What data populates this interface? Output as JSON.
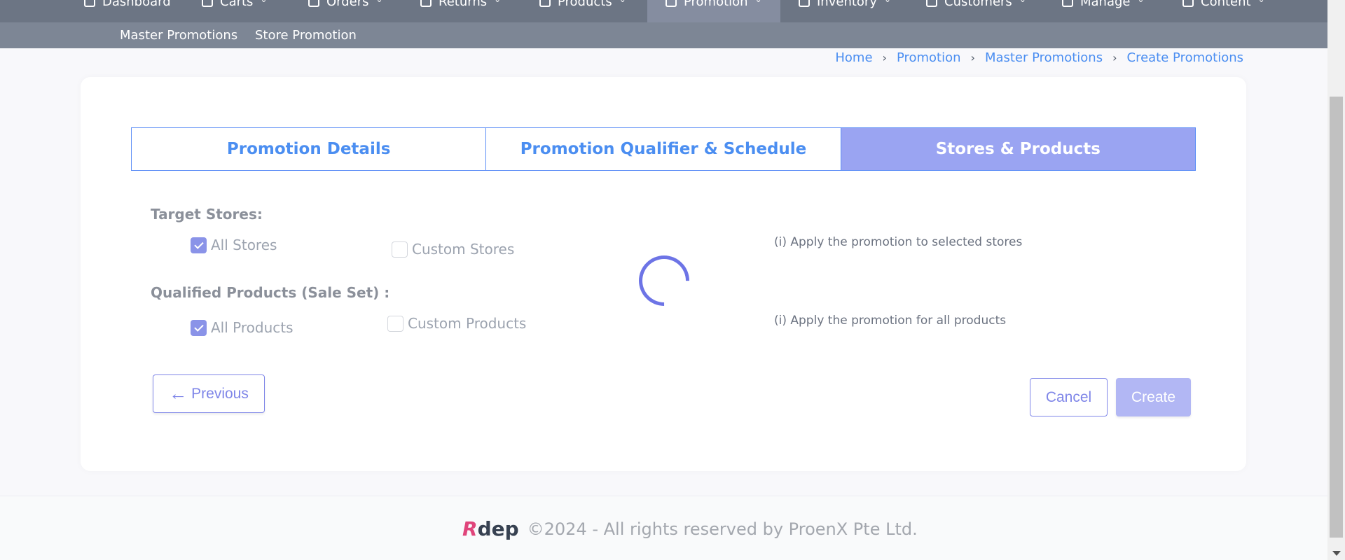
{
  "nav": {
    "items": [
      {
        "label": "Dashboard",
        "icon": "dashboard-icon"
      },
      {
        "label": "Carts",
        "icon": "cart-icon"
      },
      {
        "label": "Orders",
        "icon": "orders-icon"
      },
      {
        "label": "Returns",
        "icon": "returns-icon"
      },
      {
        "label": "Products",
        "icon": "products-icon"
      },
      {
        "label": "Promotion",
        "icon": "promotion-icon"
      },
      {
        "label": "Inventory",
        "icon": "inventory-icon"
      },
      {
        "label": "Customers",
        "icon": "customers-icon"
      },
      {
        "label": "Manage",
        "icon": "gear-icon"
      },
      {
        "label": "Content",
        "icon": "content-icon"
      }
    ],
    "active": "Promotion"
  },
  "subnav": {
    "items": [
      "Master Promotions",
      "Store Promotion"
    ]
  },
  "breadcrumb": {
    "items": [
      "Home",
      "Promotion",
      "Master Promotions",
      "Create Promotions"
    ]
  },
  "tabs": {
    "items": [
      "Promotion Details",
      "Promotion Qualifier & Schedule",
      "Stores & Products"
    ],
    "active": "Stores & Products"
  },
  "target_stores": {
    "label": "Target Stores:",
    "all_label": "All Stores",
    "all_checked": true,
    "custom_label": "Custom Stores",
    "custom_checked": false,
    "hint": "(i) Apply the promotion to selected stores"
  },
  "qualified_products": {
    "label": "Qualified Products (Sale Set) :",
    "all_label": "All Products",
    "all_checked": true,
    "custom_label": "Custom Products",
    "custom_checked": false,
    "hint": "(i) Apply the promotion for all products"
  },
  "actions": {
    "previous": "Previous",
    "cancel": "Cancel",
    "create": "Create"
  },
  "footer": {
    "logo_r": "R",
    "logo_text": "dep",
    "copyright": "©2024 - All rights reserved by ProenX Pte Ltd."
  },
  "colors": {
    "accent": "#7f86e8",
    "link": "#4b8ef1",
    "nav_bg": "#6c7584",
    "tab_active": "#9aa4f2"
  }
}
